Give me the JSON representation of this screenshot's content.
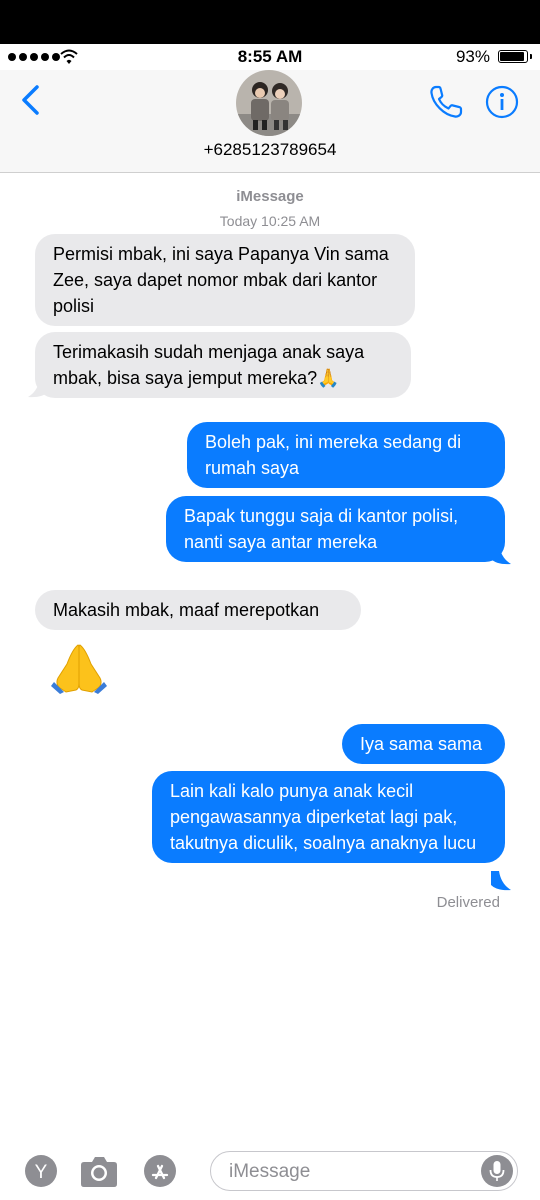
{
  "status": {
    "time": "8:55 AM",
    "battery": "93%"
  },
  "header": {
    "contact": "+6285123789654"
  },
  "thread": {
    "service": "iMessage",
    "timestamp": "Today 10:25 AM"
  },
  "messages": [
    {
      "dir": "in",
      "text": "Permisi mbak, ini saya Papanya Vin sama Zee, saya dapet nomor mbak dari kantor polisi"
    },
    {
      "dir": "in",
      "text": "Terimakasih sudah menjaga anak saya mbak, bisa saya jemput mereka?🙏"
    },
    {
      "dir": "out",
      "text": "Boleh pak, ini mereka sedang di rumah saya"
    },
    {
      "dir": "out",
      "text": "Bapak tunggu saja di kantor polisi, nanti saya antar mereka"
    },
    {
      "dir": "in",
      "text": "Makasih mbak, maaf merepotkan"
    },
    {
      "dir": "in",
      "text": "🙏",
      "emoji_only": true
    },
    {
      "dir": "out",
      "text": "Iya sama sama"
    },
    {
      "dir": "out",
      "text": "Lain kali kalo punya anak kecil pengawasannya diperketat lagi pak, takutnya diculik, soalnya anaknya lucu"
    }
  ],
  "delivery_status": "Delivered",
  "composer": {
    "placeholder": "iMessage"
  },
  "colors": {
    "outgoing": "#0a7cff",
    "incoming": "#e9e9eb",
    "accent": "#0a7cff"
  }
}
